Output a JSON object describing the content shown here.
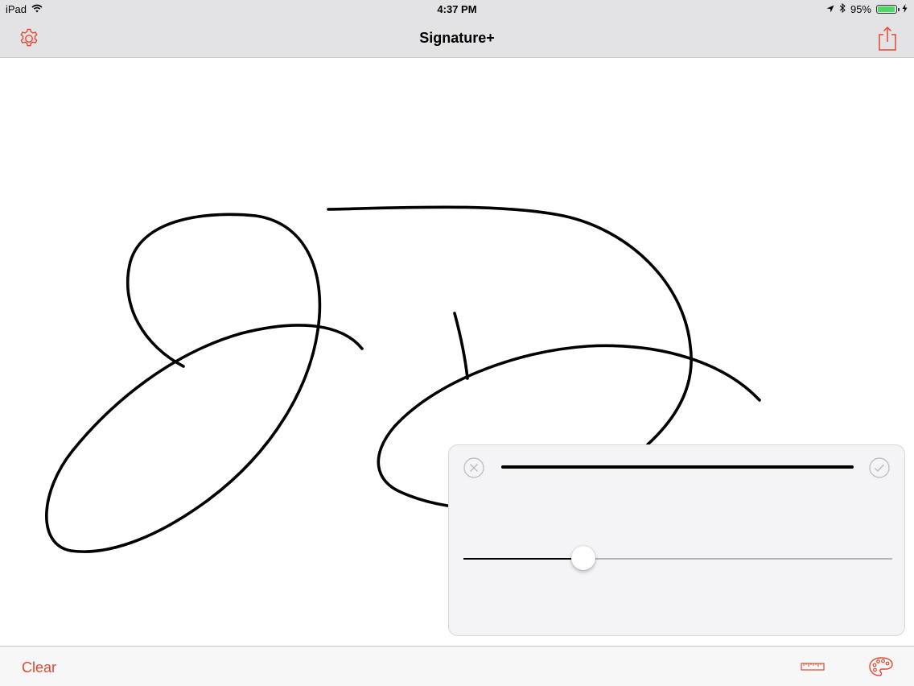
{
  "status_bar": {
    "device": "iPad",
    "time": "4:37 PM",
    "battery": "95%",
    "battery_level": 0.95,
    "icons": [
      "wifi-icon",
      "location-icon",
      "bluetooth-icon",
      "battery-icon",
      "charging-icon"
    ]
  },
  "nav": {
    "title": "Signature+",
    "left_icon": "gear-icon",
    "right_icon": "share-icon"
  },
  "popover": {
    "cancel_icon": "close-circle-icon",
    "confirm_icon": "checkmark-circle-icon",
    "stroke_width_level": 0.28
  },
  "toolbar": {
    "clear_label": "Clear",
    "ruler_icon": "ruler-icon",
    "palette_icon": "palette-icon"
  },
  "colors": {
    "accent": "#e04a2f",
    "bar_background": "#e3e3e5",
    "popover_background": "#f4f3f6",
    "ink": "#000000",
    "battery_green": "#4cd964"
  }
}
